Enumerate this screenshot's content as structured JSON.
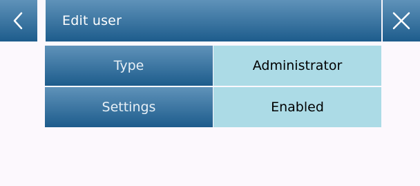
{
  "header": {
    "title": "Edit user",
    "back_icon": "chevron-left-icon",
    "close_icon": "close-icon"
  },
  "settings_rows": [
    {
      "label": "Type",
      "value": "Administrator"
    },
    {
      "label": "Settings",
      "value": "Enabled"
    }
  ],
  "colors": {
    "header_gradient_top": "#5f92b9",
    "header_gradient_bottom": "#1d5c8c",
    "value_cell": "#acdbe6",
    "background": "#fcf8fd"
  }
}
